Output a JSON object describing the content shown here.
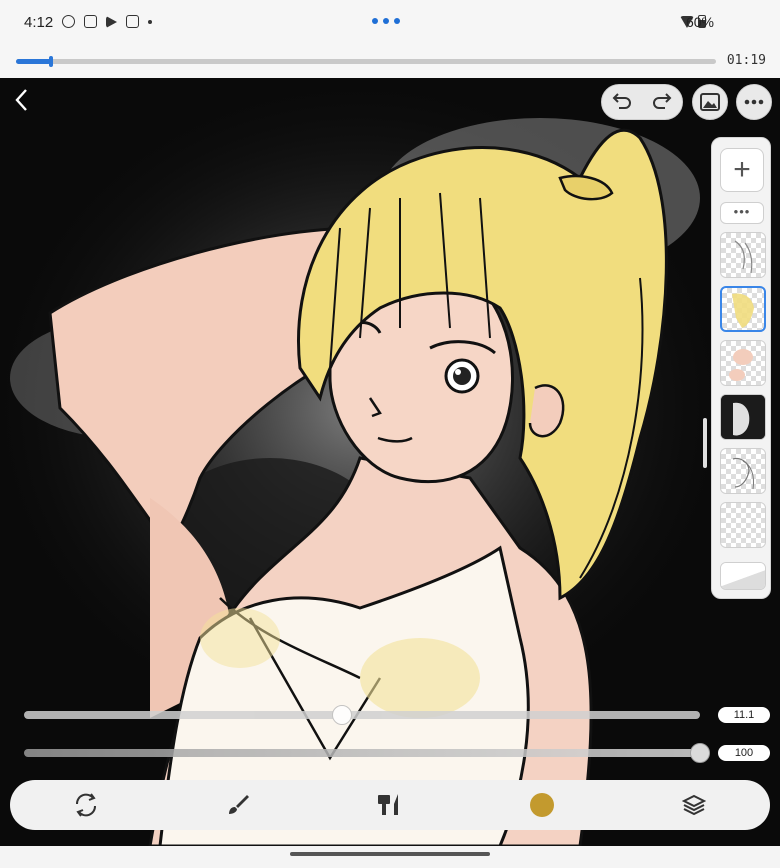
{
  "status_bar": {
    "time": "4:12",
    "battery": "60%",
    "icons": [
      "settings-icon",
      "screenshot-icon",
      "play-store-icon",
      "notification-icon",
      "dot-icon",
      "wifi-icon",
      "battery-icon"
    ]
  },
  "timelapse": {
    "duration": "01:19",
    "progress_fraction": 0.05,
    "accent": "#2a76d8"
  },
  "canvas": {
    "background": "#0a0a0a",
    "back_icon": "chevron-left-icon"
  },
  "top_controls": {
    "undo_icon": "undo-icon",
    "redo_icon": "redo-icon",
    "gallery_icon": "image-icon",
    "more_icon": "more-horizontal-icon"
  },
  "layers": {
    "add_label": "+",
    "more_label": "•••",
    "items": [
      {
        "name": "layer-lineart-sketch"
      },
      {
        "name": "layer-hair-color",
        "selected": true
      },
      {
        "name": "layer-skin-color"
      },
      {
        "name": "layer-background"
      },
      {
        "name": "layer-sketch"
      },
      {
        "name": "layer-empty"
      }
    ],
    "selected_color": "#3a86e8"
  },
  "sliders": {
    "size_value": "11.1",
    "size_fraction": 0.47,
    "opacity_value": "100",
    "opacity_fraction": 1.0
  },
  "toolbar": {
    "items": [
      "swap-icon",
      "brush-icon",
      "brush-library-icon",
      "color-swatch",
      "layers-icon"
    ],
    "current_color": "#c39a2e"
  }
}
